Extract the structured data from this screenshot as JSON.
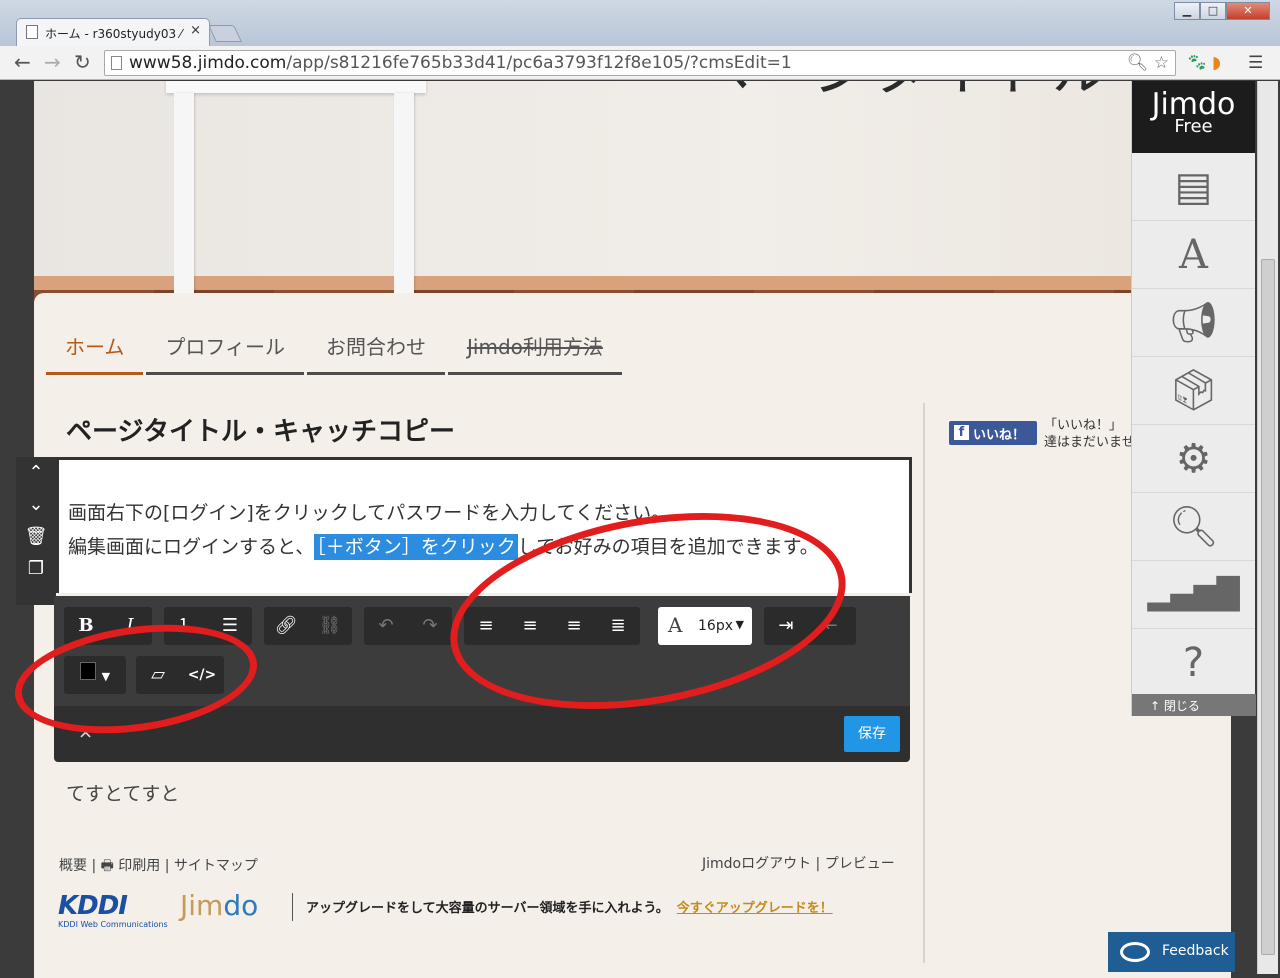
{
  "browser": {
    "tab_title": "ホーム - r360styudy03 ⁄",
    "tab_close": "×",
    "url_host": "www58.jimdo.com",
    "url_path": "/app/s81216fe765b33d41/pc6a3793f12f8e105/?cmsEdit=1",
    "window_controls": {
      "minimize": "▁",
      "maximize": "□",
      "close": "✕"
    }
  },
  "header": {
    "title": "ページタイトル"
  },
  "nav": {
    "items": [
      {
        "label": "ホーム"
      },
      {
        "label": "プロフィール"
      },
      {
        "label": "お問合わせ"
      },
      {
        "label": "Jimdo利用方法"
      }
    ]
  },
  "main": {
    "heading": "ページタイトル・キャッチコピー",
    "editor": {
      "line1": "画面右下の[ログイン]をクリックしてパスワードを入力してください。",
      "line2_before": "編集画面にログインすると、",
      "line2_selected": "［＋ボタン］をクリック",
      "line2_after": "してお好みの項目を追加できます。"
    },
    "rte": {
      "font_size": "16px",
      "save_label": "保存",
      "close_label": "×"
    },
    "body_text": "てすとてすと"
  },
  "footer": {
    "links": [
      "概要",
      "印刷用",
      "サイトマップ"
    ],
    "right_links": [
      "Jimdoログアウト",
      "プレビュー"
    ],
    "kddi_logo": "KDDI",
    "kddi_sub": "KDDI Web Communications",
    "jimdo_logo_a": "Jim",
    "jimdo_logo_b": "do",
    "upgrade_text": "アップグレードをして大容量のサーバー領域を手に入れよう。",
    "upgrade_link": "今すぐアップグレードを！"
  },
  "sidebar": {
    "fb_button": "いいね！",
    "fb_text_1": "「いいね！」",
    "fb_text_2": "達はまだいませ"
  },
  "jimdo_panel": {
    "brand": "Jimdo",
    "plan": "Free",
    "close_label": "閉じる"
  },
  "feedback": {
    "label": "Feedback"
  },
  "colors": {
    "accent": "#b45a1a",
    "save": "#2196e6",
    "annotation": "#e11d1d"
  }
}
